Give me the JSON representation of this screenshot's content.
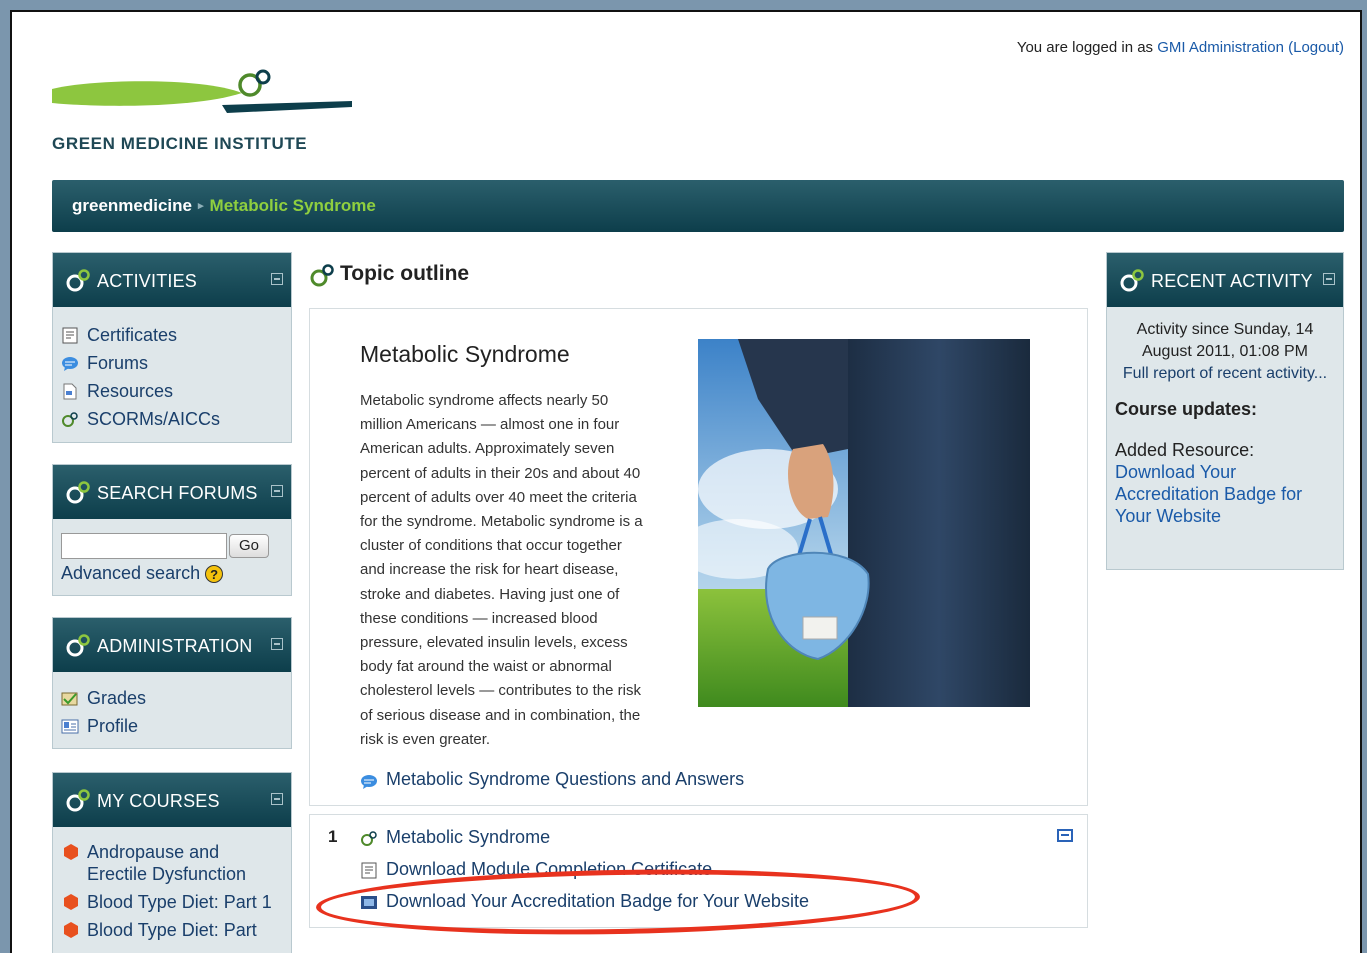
{
  "header": {
    "login_prefix": "You are logged in as",
    "user": "GMI Administration",
    "logout": "(Logout)",
    "logo_text": "GREEN MEDICINE INSTITUTE"
  },
  "breadcrumb": {
    "home": "greenmedicine",
    "separator": "▸",
    "current": "Metabolic Syndrome"
  },
  "activities": {
    "title": "ACTIVITIES",
    "items": [
      "Certificates",
      "Forums",
      "Resources",
      "SCORMs/AICCs"
    ]
  },
  "search_forums": {
    "title": "SEARCH FORUMS",
    "go": "Go",
    "advanced": "Advanced search",
    "help": "?"
  },
  "administration": {
    "title": "ADMINISTRATION",
    "items": [
      "Grades",
      "Profile"
    ]
  },
  "my_courses": {
    "title": "MY COURSES",
    "items": [
      "Andropause and Erectile Dysfunction",
      "Blood Type Diet: Part 1",
      "Blood Type Diet: Part"
    ]
  },
  "main": {
    "topic_title": "Topic outline",
    "summary_heading": "Metabolic Syndrome",
    "summary_lines": [
      "Metabolic syndrome affects nearly 50",
      "million Americans — almost one in four",
      "American adults. Approximately seven",
      "percent of adults in their 20s and about 40",
      "percent of adults over 40 meet the criteria",
      "for the syndrome. Metabolic syndrome is a",
      "cluster of conditions that occur together",
      "and increase the risk for heart disease,",
      "stroke and diabetes. Having just one of",
      "these conditions — increased blood",
      "pressure, elevated insulin levels, excess",
      "body fat around the waist or abnormal",
      "cholesterol levels — contributes to the risk",
      "of serious disease and in combination, the",
      "risk is even greater."
    ],
    "qa_link": "Metabolic Syndrome Questions and Answers",
    "section": {
      "number": "1",
      "items": [
        "Metabolic Syndrome",
        "Download Module Completion Certificate",
        "Download Your Accreditation Badge for Your Website"
      ]
    }
  },
  "recent_activity": {
    "title": "RECENT ACTIVITY",
    "since_line1": "Activity since Sunday, 14",
    "since_line2": "August 2011, 01:08 PM",
    "full_report": "Full report of recent activity...",
    "course_updates": "Course updates:",
    "added_label": "Added Resource:",
    "added_lines": [
      "Download Your",
      "Accreditation Badge for",
      "Your Website"
    ]
  },
  "colors": {
    "nav_dark": "#0d3e4b",
    "breadcrumb_current": "#8fcf3f",
    "link": "#1a5aa8",
    "highlight_oval": "#e8321e"
  }
}
